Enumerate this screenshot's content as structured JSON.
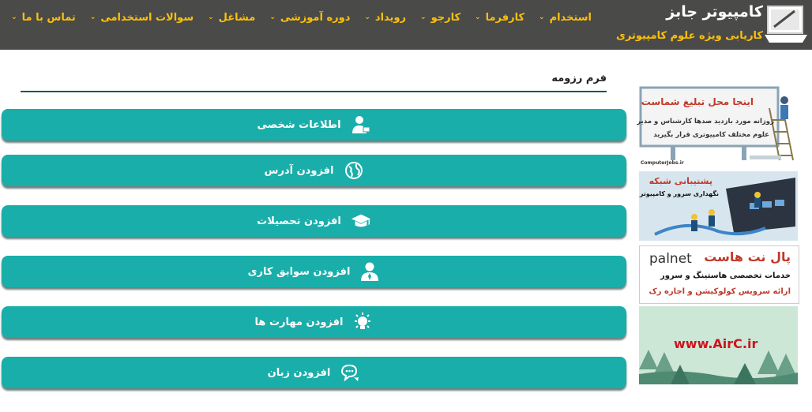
{
  "header": {
    "site_title": "کامپیوتر جابز",
    "site_subtitle": "کاریابی ویژه علوم کامپیوتری",
    "nav": [
      {
        "label": "استخدام"
      },
      {
        "label": "کارفرما"
      },
      {
        "label": "کارجو"
      },
      {
        "label": "رویداد"
      },
      {
        "label": "دوره آموزشی"
      },
      {
        "label": "مشاغل"
      },
      {
        "label": "سوالات استخدامی"
      },
      {
        "label": "تماس با ما"
      }
    ]
  },
  "form": {
    "title": "فرم رزومه",
    "sections": [
      {
        "label": "اطلاعات شخصی",
        "icon": "person-icon"
      },
      {
        "label": "افزودن آدرس",
        "icon": "globe-icon"
      },
      {
        "label": "افزودن تحصیلات",
        "icon": "graduation-cap-icon"
      },
      {
        "label": "افزودن سوابق کاری",
        "icon": "user-icon"
      },
      {
        "label": "افزودن مهارت ها",
        "icon": "lightbulb-icon"
      },
      {
        "label": "افزودن زبان",
        "icon": "chat-icon"
      }
    ]
  },
  "ads": {
    "ad1": {
      "heading": "اینجا محل تبلیغ شماست",
      "line1": "روزانه مورد بازدید صدها کارشناس و مدیر",
      "line2": "علوم مختلف کامپیوتری قرار بگیرید",
      "footer": "ComputerJobs.ir"
    },
    "ad2": {
      "heading": "پشتیبانی شبکه",
      "line1": "نگهداری سرور و کامپیوتر"
    },
    "ad3": {
      "brand": "palnet",
      "heading": "پال نت هاست",
      "line1": "خدمات تخصصی هاستینگ و سرور",
      "line2": "ارائه سرویس کولوکیشن و اجاره رک"
    },
    "ad4": {
      "text": "www.AirC.ir"
    }
  },
  "colors": {
    "topbar": "#4a4a48",
    "accent": "#ffc107",
    "section": "#1aaeaa",
    "line": "#155a4d"
  }
}
